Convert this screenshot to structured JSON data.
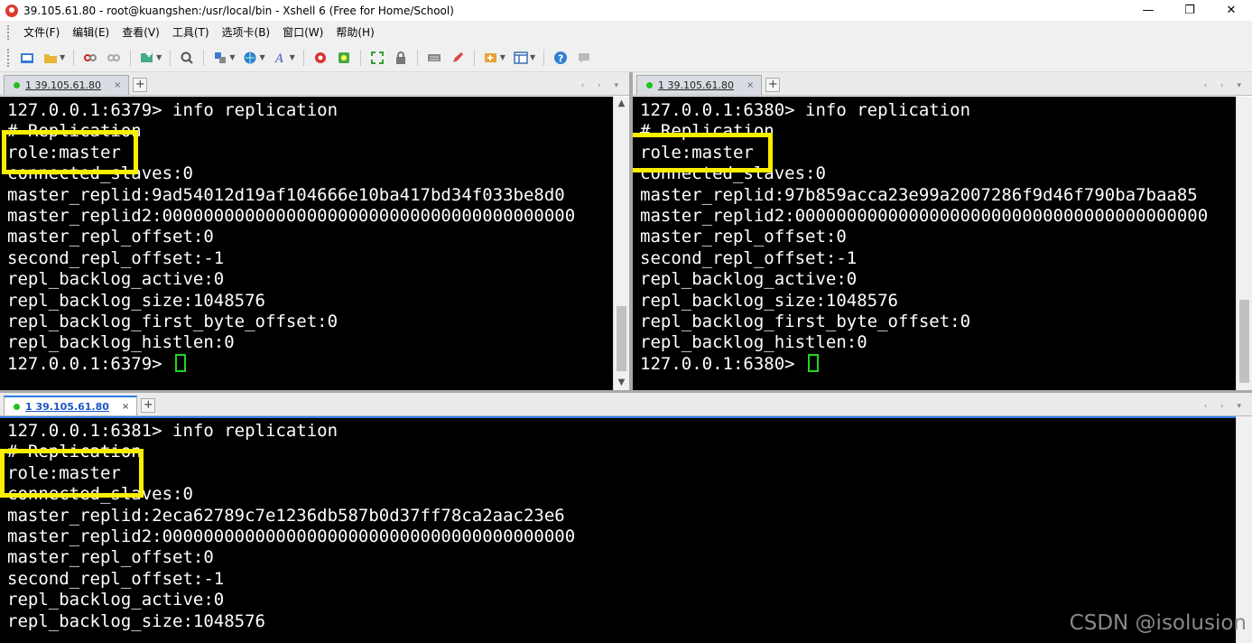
{
  "window": {
    "title": "39.105.61.80 - root@kuangshen:/usr/local/bin - Xshell 6 (Free for Home/School)",
    "minimize": "—",
    "maximize": "❐",
    "close": "✕"
  },
  "menu": [
    "文件(F)",
    "编辑(E)",
    "查看(V)",
    "工具(T)",
    "选项卡(B)",
    "窗口(W)",
    "帮助(H)"
  ],
  "toolbar_icons": [
    "new-session-icon",
    "open-folder-icon",
    "connect-icon",
    "disconnect-icon",
    "new-tab-icon",
    "search-icon",
    "properties-icon",
    "globe-icon",
    "font-icon",
    "xshell-icon",
    "xftp-icon",
    "fullscreen-icon",
    "lock-icon",
    "keyboard-icon",
    "pen-icon",
    "compose-icon",
    "layout-icon",
    "help-icon",
    "chat-icon"
  ],
  "panes": [
    {
      "tab_number": "1",
      "tab_host": "39.105.61.80",
      "active": false,
      "lines": [
        "127.0.0.1:6379> info replication",
        "# Replication",
        "role:master",
        "connected_slaves:0",
        "master_replid:9ad54012d19af104666e10ba417bd34f033be8d0",
        "master_replid2:0000000000000000000000000000000000000000",
        "master_repl_offset:0",
        "second_repl_offset:-1",
        "repl_backlog_active:0",
        "repl_backlog_size:1048576",
        "repl_backlog_first_byte_offset:0",
        "repl_backlog_histlen:0"
      ],
      "prompt": "127.0.0.1:6379> "
    },
    {
      "tab_number": "1",
      "tab_host": "39.105.61.80",
      "active": false,
      "lines": [
        "127.0.0.1:6380> info replication",
        "# Replication",
        "role:master",
        "connected_slaves:0",
        "master_replid:97b859acca23e99a2007286f9d46f790ba7baa85",
        "master_replid2:0000000000000000000000000000000000000000",
        "master_repl_offset:0",
        "second_repl_offset:-1",
        "repl_backlog_active:0",
        "repl_backlog_size:1048576",
        "repl_backlog_first_byte_offset:0",
        "repl_backlog_histlen:0"
      ],
      "prompt": "127.0.0.1:6380> "
    },
    {
      "tab_number": "1",
      "tab_host": "39.105.61.80",
      "active": true,
      "lines": [
        "127.0.0.1:6381> info replication",
        "# Replication",
        "role:master",
        "connected_slaves:0",
        "master_replid:2eca62789c7e1236db587b0d37ff78ca2aac23e6",
        "master_replid2:0000000000000000000000000000000000000000",
        "master_repl_offset:0",
        "second_repl_offset:-1",
        "repl_backlog_active:0",
        "repl_backlog_size:1048576"
      ]
    }
  ],
  "tab_close": "×",
  "tab_add": "+",
  "tab_nav": "‹ › ▾",
  "watermark": "CSDN @isolusion",
  "colors": {
    "highlight": "#fbef00",
    "cursor": "#22d422",
    "terminal_bg": "#000000",
    "terminal_fg": "#ffffff"
  }
}
